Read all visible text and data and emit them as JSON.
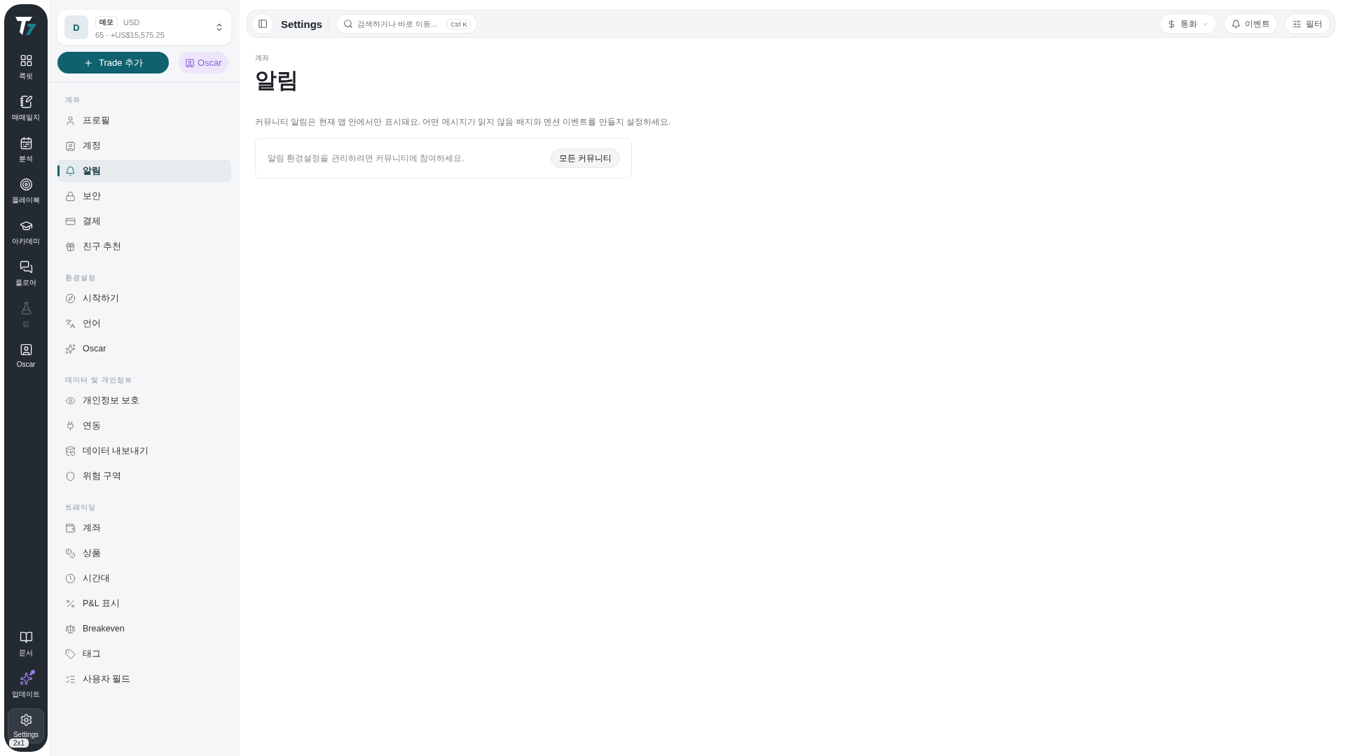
{
  "rail": {
    "items": [
      {
        "label": "콕핏",
        "selected": false,
        "disabled": false,
        "notification": false
      },
      {
        "label": "매매일지",
        "selected": false,
        "disabled": false,
        "notification": false
      },
      {
        "label": "분석",
        "selected": false,
        "disabled": false,
        "notification": false
      },
      {
        "label": "플레이북",
        "selected": false,
        "disabled": false,
        "notification": false
      },
      {
        "label": "아카데미",
        "selected": false,
        "disabled": false,
        "notification": false
      },
      {
        "label": "플로어",
        "selected": false,
        "disabled": false,
        "notification": false
      },
      {
        "label": "랩",
        "selected": false,
        "disabled": true,
        "notification": false
      },
      {
        "label": "Oscar",
        "selected": false,
        "disabled": false,
        "notification": false
      }
    ],
    "bottom_items": [
      {
        "label": "문서",
        "selected": false,
        "disabled": false,
        "notification": false
      },
      {
        "label": "업데이트",
        "selected": false,
        "disabled": false,
        "notification": true
      },
      {
        "label": "Settings",
        "selected": true,
        "disabled": false,
        "notification": false
      }
    ],
    "badge": "2x1"
  },
  "account": {
    "avatar": "D",
    "tag": "데모",
    "currency": "USD",
    "summary": "65 · +US$15,575.25"
  },
  "add_trade": "Trade 추가",
  "oscar_button": "Oscar",
  "sections": [
    {
      "title": "계좌",
      "items": [
        {
          "label": "프로필",
          "selected": false
        },
        {
          "label": "계정",
          "selected": false
        },
        {
          "label": "알림",
          "selected": true
        },
        {
          "label": "보안",
          "selected": false
        },
        {
          "label": "결제",
          "selected": false
        },
        {
          "label": "친구 추천",
          "selected": false
        }
      ]
    },
    {
      "title": "환경설정",
      "items": [
        {
          "label": "시작하기",
          "selected": false
        },
        {
          "label": "언어",
          "selected": false
        },
        {
          "label": "Oscar",
          "selected": false
        }
      ]
    },
    {
      "title": "데이터 및 개인정보",
      "items": [
        {
          "label": "개인정보 보호",
          "selected": false
        },
        {
          "label": "연동",
          "selected": false
        },
        {
          "label": "데이터 내보내기",
          "selected": false
        },
        {
          "label": "위험 구역",
          "selected": false
        }
      ]
    },
    {
      "title": "트레이딩",
      "items": [
        {
          "label": "계좌",
          "selected": false
        },
        {
          "label": "상품",
          "selected": false
        },
        {
          "label": "시간대",
          "selected": false
        },
        {
          "label": "P&L 표시",
          "selected": false
        },
        {
          "label": "Breakeven",
          "selected": false
        },
        {
          "label": "태그",
          "selected": false
        },
        {
          "label": "사용자 필드",
          "selected": false
        }
      ]
    }
  ],
  "topbar": {
    "title": "Settings",
    "search": {
      "placeholder": "검색하거나 바로 이동...",
      "shortcut": "Ctrl K"
    },
    "buttons": [
      {
        "label": "통화",
        "dropdown": true
      },
      {
        "label": "이벤트",
        "dropdown": false
      },
      {
        "label": "필터",
        "dropdown": false
      }
    ]
  },
  "content": {
    "breadcrumb": "계좌",
    "title": "알림",
    "description": "커뮤니티 알림은 현재 앱 안에서만 표시돼요. 어떤 메시지가 읽지 않음 배지와 멘션 이벤트를 만들지 설정하세요.",
    "card": {
      "text": "알림 환경설정을 관리하려면 커뮤니티에 참여하세요.",
      "button": "모든 커뮤니티"
    }
  }
}
